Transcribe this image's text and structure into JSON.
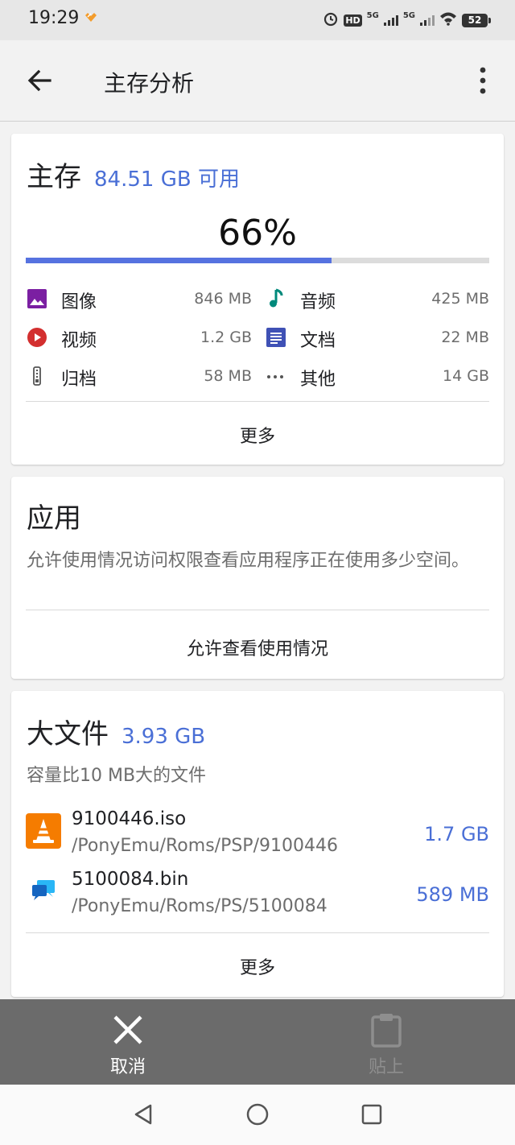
{
  "status_bar": {
    "time": "19:29",
    "battery": "52",
    "network_1": "5G",
    "network_2": "5G",
    "hd": "HD"
  },
  "app_bar": {
    "title": "主存分析",
    "back_icon": "arrow-left-icon",
    "menu_icon": "more-vert-icon"
  },
  "storage": {
    "title": "主存",
    "available": "84.51 GB 可用",
    "percent_text": "66%",
    "percent_value": 0.66,
    "accent": "#5672e0",
    "categories": [
      {
        "label": "图像",
        "value": "846 MB",
        "icon": "image-icon",
        "color": "#7b1fa2"
      },
      {
        "label": "音频",
        "value": "425 MB",
        "icon": "music-note-icon",
        "color": "#00897b"
      },
      {
        "label": "视频",
        "value": "1.2 GB",
        "icon": "play-circle-icon",
        "color": "#d32f2f"
      },
      {
        "label": "文档",
        "value": "22 MB",
        "icon": "document-icon",
        "color": "#3f51b5"
      },
      {
        "label": "归档",
        "value": "58 MB",
        "icon": "archive-zip-icon",
        "color": "#555555"
      },
      {
        "label": "其他",
        "value": "14 GB",
        "icon": "more-horiz-icon",
        "color": "#555555"
      }
    ],
    "more_label": "更多"
  },
  "apps": {
    "title": "应用",
    "description": "允许使用情况访问权限查看应用程序正在使用多少空间。",
    "action_label": "允许查看使用情况"
  },
  "large_files": {
    "title": "大文件",
    "total": "3.93 GB",
    "subtitle": "容量比10 MB大的文件",
    "files": [
      {
        "name": "9100446.iso",
        "path": "/PonyEmu/Roms/PSP/9100446",
        "size": "1.7 GB",
        "icon": "vlc-cone-icon"
      },
      {
        "name": "5100084.bin",
        "path": "/PonyEmu/Roms/PS/5100084",
        "size": "589 MB",
        "icon": "chat-bubbles-icon"
      }
    ],
    "more_label": "更多"
  },
  "action_bar": {
    "cancel_label": "取消",
    "paste_label": "贴上"
  },
  "nav_bar": {
    "back": "nav-back-icon",
    "home": "nav-home-icon",
    "recents": "nav-recents-icon"
  }
}
